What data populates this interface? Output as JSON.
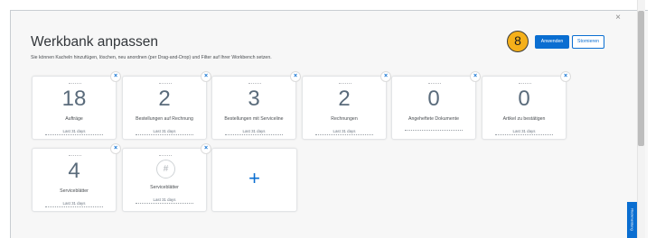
{
  "dialog": {
    "title": "Werkbank anpassen",
    "subtitle": "Sie können Kacheln hinzufügen, löschen, neu anordnen (per Drag-and-Drop) und Filter auf Ihrer Workbench setzen.",
    "close_glyph": "×",
    "step_marker": "8",
    "apply_label": "Anwenden",
    "cancel_label": "Stornieren"
  },
  "tiles": [
    {
      "number": "18",
      "label": "Aufträge",
      "link": "Last 31 days"
    },
    {
      "number": "2",
      "label": "Bestellungen auf Rechnung",
      "link": "Last 31 days"
    },
    {
      "number": "3",
      "label": "Bestellungen mit Serviceline",
      "link": "Last 31 days"
    },
    {
      "number": "2",
      "label": "Rechnungen",
      "link": "Last 31 days"
    },
    {
      "number": "0",
      "label": "Angeheftete Dokumente",
      "link": ""
    },
    {
      "number": "0",
      "label": "Artikel zu bestätigen",
      "link": "Last 31 days"
    },
    {
      "number": "4",
      "label": "Serviceblätter",
      "link": "Last 31 days"
    },
    {
      "number": "#",
      "label": "Serviceblätter",
      "link": "Last 31 days"
    }
  ],
  "remove_glyph": "×",
  "add_tile_glyph": "+",
  "feedback_label": "Rückmeldung",
  "colors": {
    "accent": "#0a6ed1",
    "marker": "#f5b01a",
    "background": "#f7f7f7",
    "tile": "#ffffff"
  }
}
